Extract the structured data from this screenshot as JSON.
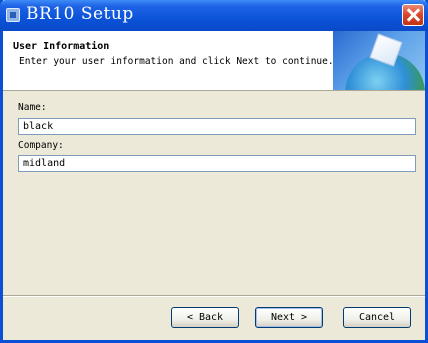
{
  "window": {
    "title": "BR10 Setup"
  },
  "header": {
    "title": "User Information",
    "subtitle": "Enter your user information and click Next to continue."
  },
  "form": {
    "name_label": "Name:",
    "name_value": "black",
    "company_label": "Company:",
    "company_value": "midland"
  },
  "buttons": {
    "back_label": "< Back",
    "next_label": "Next >",
    "cancel_label": "Cancel"
  },
  "colors": {
    "titlebar": "#0a53d8",
    "window_face": "#ece9d8",
    "close_button": "#d8452a"
  }
}
